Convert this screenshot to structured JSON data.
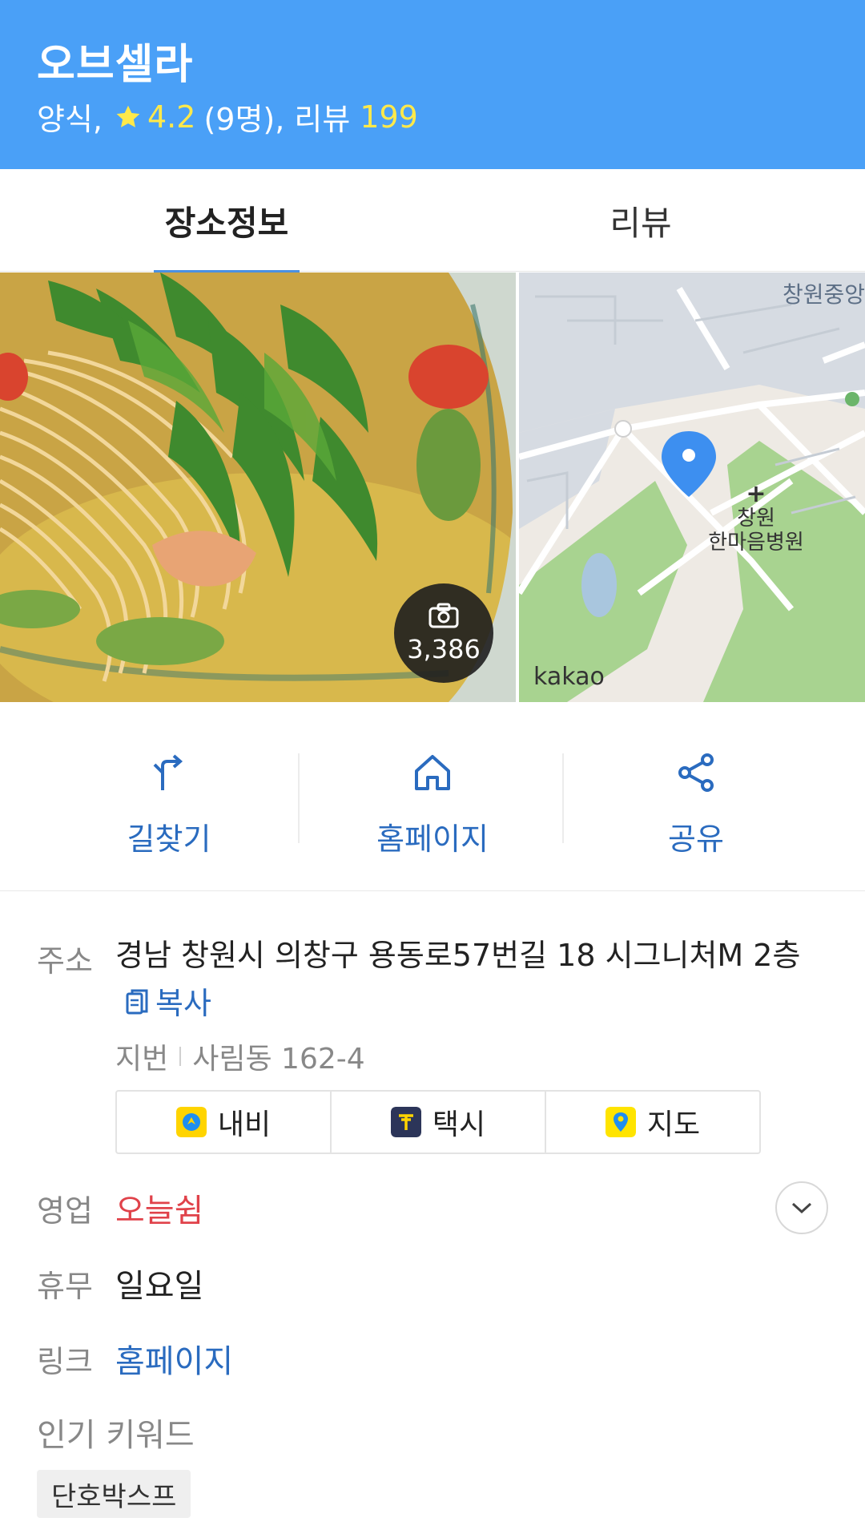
{
  "header": {
    "title": "오브셀라",
    "category": "양식,",
    "rating": "4.2",
    "rating_count": "(9명), 리뷰",
    "review_count": "199",
    "bg_color": "#4aa0f7"
  },
  "tabs": [
    {
      "label": "장소정보",
      "active": true
    },
    {
      "label": "리뷰",
      "active": false
    }
  ],
  "media": {
    "photo_count": "3,386",
    "map_brand": "kakao",
    "map_label_top": "창원중앙",
    "map_hospital_line1": "창원",
    "map_hospital_line2": "한마음병원",
    "hospital_cross": "+"
  },
  "actions": [
    {
      "label": "길찾기",
      "icon": "directions-icon"
    },
    {
      "label": "홈페이지",
      "icon": "home-icon"
    },
    {
      "label": "공유",
      "icon": "share-icon"
    }
  ],
  "details": {
    "address_label": "주소",
    "address": "경남 창원시 의창구 용동로57번길 18 시그니처M 2층",
    "copy_label": "복사",
    "jibun_label": "지번",
    "jibun": "사림동 162-4",
    "nav_buttons": [
      {
        "label": "내비",
        "icon": "kakaonavi-icon",
        "color": "#ffd400"
      },
      {
        "label": "택시",
        "icon": "kakaot-taxi-icon",
        "color": "#2c3559"
      },
      {
        "label": "지도",
        "icon": "kakaomap-icon",
        "color": "#ffe400"
      }
    ],
    "hours_label": "영업",
    "hours_value": "오늘쉼",
    "holiday_label": "휴무",
    "holiday_value": "일요일",
    "link_label": "링크",
    "link_value": "홈페이지",
    "keywords_label": "인기 키워드",
    "keywords": [
      "단호박스프"
    ]
  }
}
